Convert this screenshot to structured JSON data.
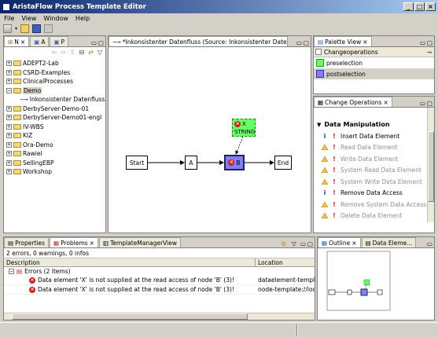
{
  "window": {
    "title": "AristaFlow Process Template Editor"
  },
  "menu": [
    "File",
    "View",
    "Window",
    "Help"
  ],
  "navigator": {
    "tabs": [
      "N",
      "A",
      "P"
    ],
    "items": [
      {
        "label": "ADEPT2-Lab",
        "expanded": false
      },
      {
        "label": "CSRD-Examples",
        "expanded": false
      },
      {
        "label": "ClinicalProcesses",
        "expanded": false
      },
      {
        "label": "Demo",
        "expanded": true,
        "selected": true
      },
      {
        "label": "Inkonsistenter Datenfluss.",
        "child": true
      },
      {
        "label": "DerbyServer-Demo-01",
        "expanded": false
      },
      {
        "label": "DerbyServer-Demo01-engl",
        "expanded": false
      },
      {
        "label": "IV-WBS",
        "expanded": false
      },
      {
        "label": "KIZ",
        "expanded": false
      },
      {
        "label": "Ora-Demo",
        "expanded": false
      },
      {
        "label": "Rawiel",
        "expanded": false
      },
      {
        "label": "SellingEBP",
        "expanded": false
      },
      {
        "label": "Workshop",
        "expanded": false
      }
    ]
  },
  "editor": {
    "tab_label": "*Inkonsistenter Datenfluss (Source: Inkonsistenter Datenfl...",
    "nodes": {
      "start": "Start",
      "a": "A",
      "b": "B",
      "end": "End"
    },
    "data_element": {
      "name": "X",
      "type": "STRING"
    }
  },
  "palette": {
    "title": "Palette View",
    "group": "Changeoperations",
    "items": [
      {
        "label": "preselection",
        "color": "#66ff66"
      },
      {
        "label": "postselection",
        "color": "#8080ff"
      }
    ]
  },
  "change_operations": {
    "title": "Change Operations",
    "section": "Data Manipulation",
    "items": [
      {
        "label": "Insert Data Element",
        "status": "info",
        "enabled": true
      },
      {
        "label": "Read Data Element",
        "status": "warn",
        "enabled": false
      },
      {
        "label": "Write Data Element",
        "status": "warn",
        "enabled": false
      },
      {
        "label": "System Read Data Element",
        "status": "warn",
        "enabled": false
      },
      {
        "label": "System Write Data Element",
        "status": "warn",
        "enabled": false
      },
      {
        "label": "Remove Data Access",
        "status": "info",
        "enabled": true
      },
      {
        "label": "Remove System Data Access",
        "status": "warn",
        "enabled": false
      },
      {
        "label": "Delete Data Element",
        "status": "warn",
        "enabled": false
      }
    ]
  },
  "bottom": {
    "tabs": [
      "Properties",
      "Problems",
      "TemplateManagerView"
    ],
    "summary": "2 errors, 0 warnings, 0 infos",
    "columns": [
      "Description",
      "Location"
    ],
    "group": "Errors (2 items)",
    "errors": [
      {
        "description": "Data element 'X' is not supplied at the read access of node 'B' (3)!",
        "location": "dataelement-template:"
      },
      {
        "description": "Data element 'X' is not supplied at the read access of node 'B' (3)!",
        "location": "node-template://localh"
      }
    ]
  },
  "outline": {
    "tabs": [
      "Outline",
      "Data Eleme..."
    ]
  },
  "colors": {
    "title_start": "#0a246a",
    "title_end": "#a6caf0",
    "selected_node": "#8080ff",
    "data_element": "#66ff66",
    "error": "#d02020"
  }
}
